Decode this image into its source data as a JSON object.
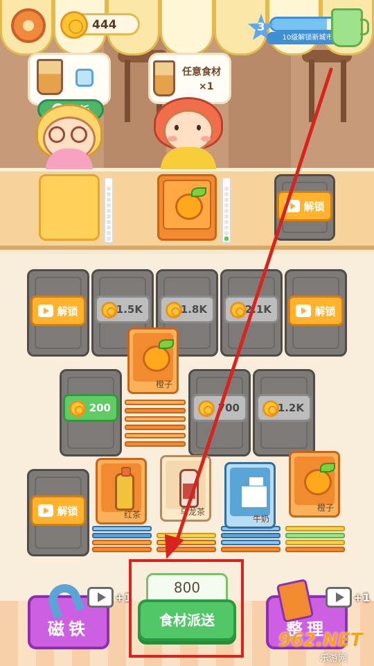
{
  "hud": {
    "coins": "444",
    "level": "3",
    "level_progress": 0.85,
    "level_caption": "10级解锁新城市"
  },
  "customers": [
    {
      "order_items": [
        "drink-icon",
        "ice-icon"
      ],
      "refresh_label": "刷新"
    },
    {
      "order_text": "任意食材",
      "order_count": "×1"
    }
  ],
  "counter": {
    "left_progress": 0,
    "middle_progress": 1,
    "right_unlock_label": "解锁"
  },
  "grid": {
    "row1": [
      {
        "type": "unlock",
        "label": "解锁"
      },
      {
        "type": "price",
        "label": "1.5K"
      },
      {
        "type": "price",
        "label": "1.8K"
      },
      {
        "type": "price",
        "label": "2.1K"
      },
      {
        "type": "unlock",
        "label": "解锁"
      }
    ],
    "row2": [
      {
        "type": "price",
        "label": "200",
        "affordable": true
      },
      {
        "type": "stack",
        "label": "橙子"
      },
      {
        "type": "price",
        "label": "700"
      },
      {
        "type": "price",
        "label": "1.2K"
      }
    ],
    "row3": [
      {
        "type": "unlock",
        "label": "解锁"
      },
      {
        "type": "stack",
        "label": "红茶"
      },
      {
        "type": "stack",
        "label": "乌龙茶"
      },
      {
        "type": "stack",
        "label": "牛奶"
      },
      {
        "type": "stack",
        "label": "橙子"
      }
    ]
  },
  "controls": {
    "magnet_label": "磁铁",
    "sort_label": "整理",
    "magnet_bonus": "+1",
    "sort_bonus": "+1",
    "dispatch_count": "800",
    "dispatch_label": "食材派送"
  },
  "watermark": {
    "main": "962.NET",
    "sub": "乐游网"
  },
  "colors": {
    "highlight": "#d8241c",
    "dispatch": "#52c768",
    "unlock": "#ffb22b",
    "purple": "#cd5fe3"
  }
}
